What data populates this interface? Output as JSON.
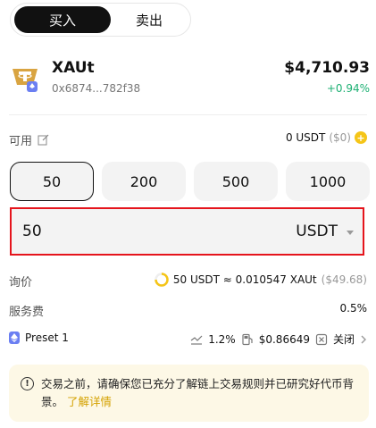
{
  "tabs": {
    "buy": "买入",
    "sell": "卖出"
  },
  "token": {
    "symbol": "XAUt",
    "address": "0x6874...782f38",
    "price": "$4,710.93",
    "change": "+0.94%",
    "logo_icon": "tether-gold-icon",
    "chain_icon": "ethereum-icon"
  },
  "available": {
    "label": "可用",
    "edit_icon": "edit-icon",
    "amount": "0 USDT",
    "usd": "($0)",
    "add_icon": "plus-coin-icon"
  },
  "quick_amounts": [
    "50",
    "200",
    "500",
    "1000"
  ],
  "input": {
    "value": "50",
    "unit": "USDT"
  },
  "quote": {
    "label": "询价",
    "text": "50 USDT ≈ 0.010547 XAUt",
    "usd": "($49.68)"
  },
  "fee": {
    "label": "服务费",
    "value": "0.5%"
  },
  "preset": {
    "label": "Preset 1",
    "slippage": "1.2%",
    "gas": "$0.86649",
    "mev": "关闭"
  },
  "notice": {
    "text": "交易之前，请确保您已充分了解链上交易规则并已研究好代币背景。",
    "link": "了解详情"
  },
  "colors": {
    "accent_green": "#1db073",
    "highlight_red": "#e5141c",
    "gold": "#f5c518",
    "notice_bg": "#fdf8e6"
  }
}
